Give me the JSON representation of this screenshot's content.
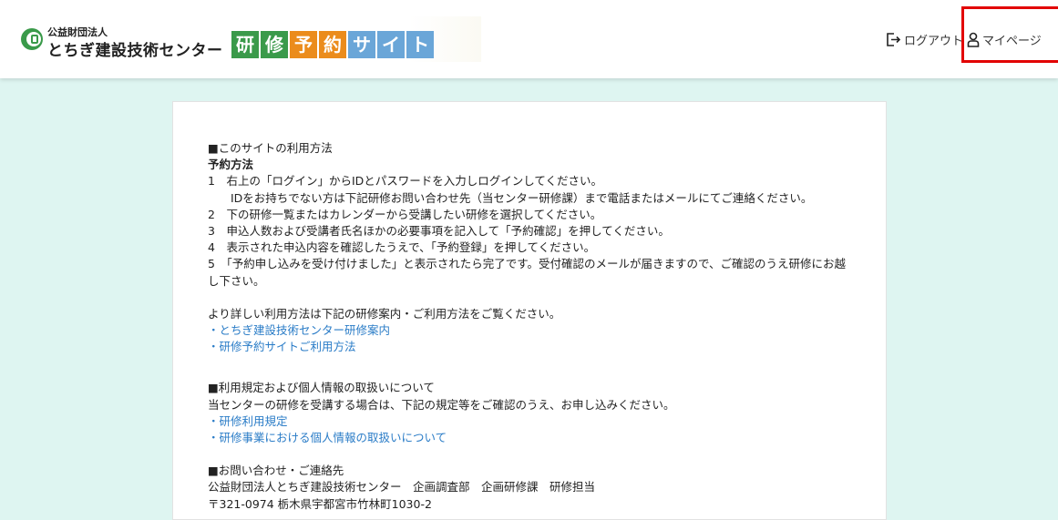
{
  "header": {
    "org_small": "公益財団法人",
    "org_name": "とちぎ建設技術センター",
    "site_title_chars": [
      {
        "char": "研",
        "color": "#3a9a4a"
      },
      {
        "char": "修",
        "color": "#3a9a4a"
      },
      {
        "char": "予",
        "color": "#eb8c1c"
      },
      {
        "char": "約",
        "color": "#eb8c1c"
      },
      {
        "char": "サ",
        "color": "#6aa6d8"
      },
      {
        "char": "イ",
        "color": "#6aa6d8"
      },
      {
        "char": "ト",
        "color": "#6aa6d8"
      }
    ],
    "logout_label": "ログアウト",
    "logout_icon": "logout-icon",
    "mypage_label": "マイページ",
    "mypage_icon": "user-icon",
    "highlight_color": "#e20000"
  },
  "content": {
    "usage_heading": "■このサイトの利用方法",
    "reserve_heading": "予約方法",
    "step1": "1　右上の「ログイン」からIDとパスワードを入力しログインしてください。",
    "step1_sub": "IDをお持ちでない方は下記研修お問い合わせ先（当センター研修課）まで電話またはメールにてご連絡ください。",
    "step2": "2　下の研修一覧またはカレンダーから受講したい研修を選択してください。",
    "step3": "3　申込人数および受講者氏名ほかの必要事項を記入して「予約確認」を押してください。",
    "step4": "4　表示された申込内容を確認したうえで、「予約登録」を押してください。",
    "step5": "5　「予約申し込みを受け付けました」と表示されたら完了です。受付確認のメールが届きますので、ご確認のうえ研修にお越し下さい。",
    "detail_intro": "より詳しい利用方法は下記の研修案内・ご利用方法をご覧ください。",
    "link_guide": "・とちぎ建設技術センター研修案内",
    "link_howto": "・研修予約サイトご利用方法",
    "rules_heading": "■利用規定および個人情報の取扱いについて",
    "rules_intro": "当センターの研修を受講する場合は、下記の規定等をご確認のうえ、お申し込みください。",
    "link_rules": "・研修利用規定",
    "link_privacy": "・研修事業における個人情報の取扱いについて",
    "contact_heading": "■お問い合わせ・ご連絡先",
    "contact_org": "公益財団法人とちぎ建設技術センター　企画調査部　企画研修課　研修担当",
    "contact_address": "〒321-0974 栃木県宇都宮市竹林町1030-2"
  },
  "colors": {
    "background": "#def5f1",
    "link": "#2a7cc7"
  }
}
